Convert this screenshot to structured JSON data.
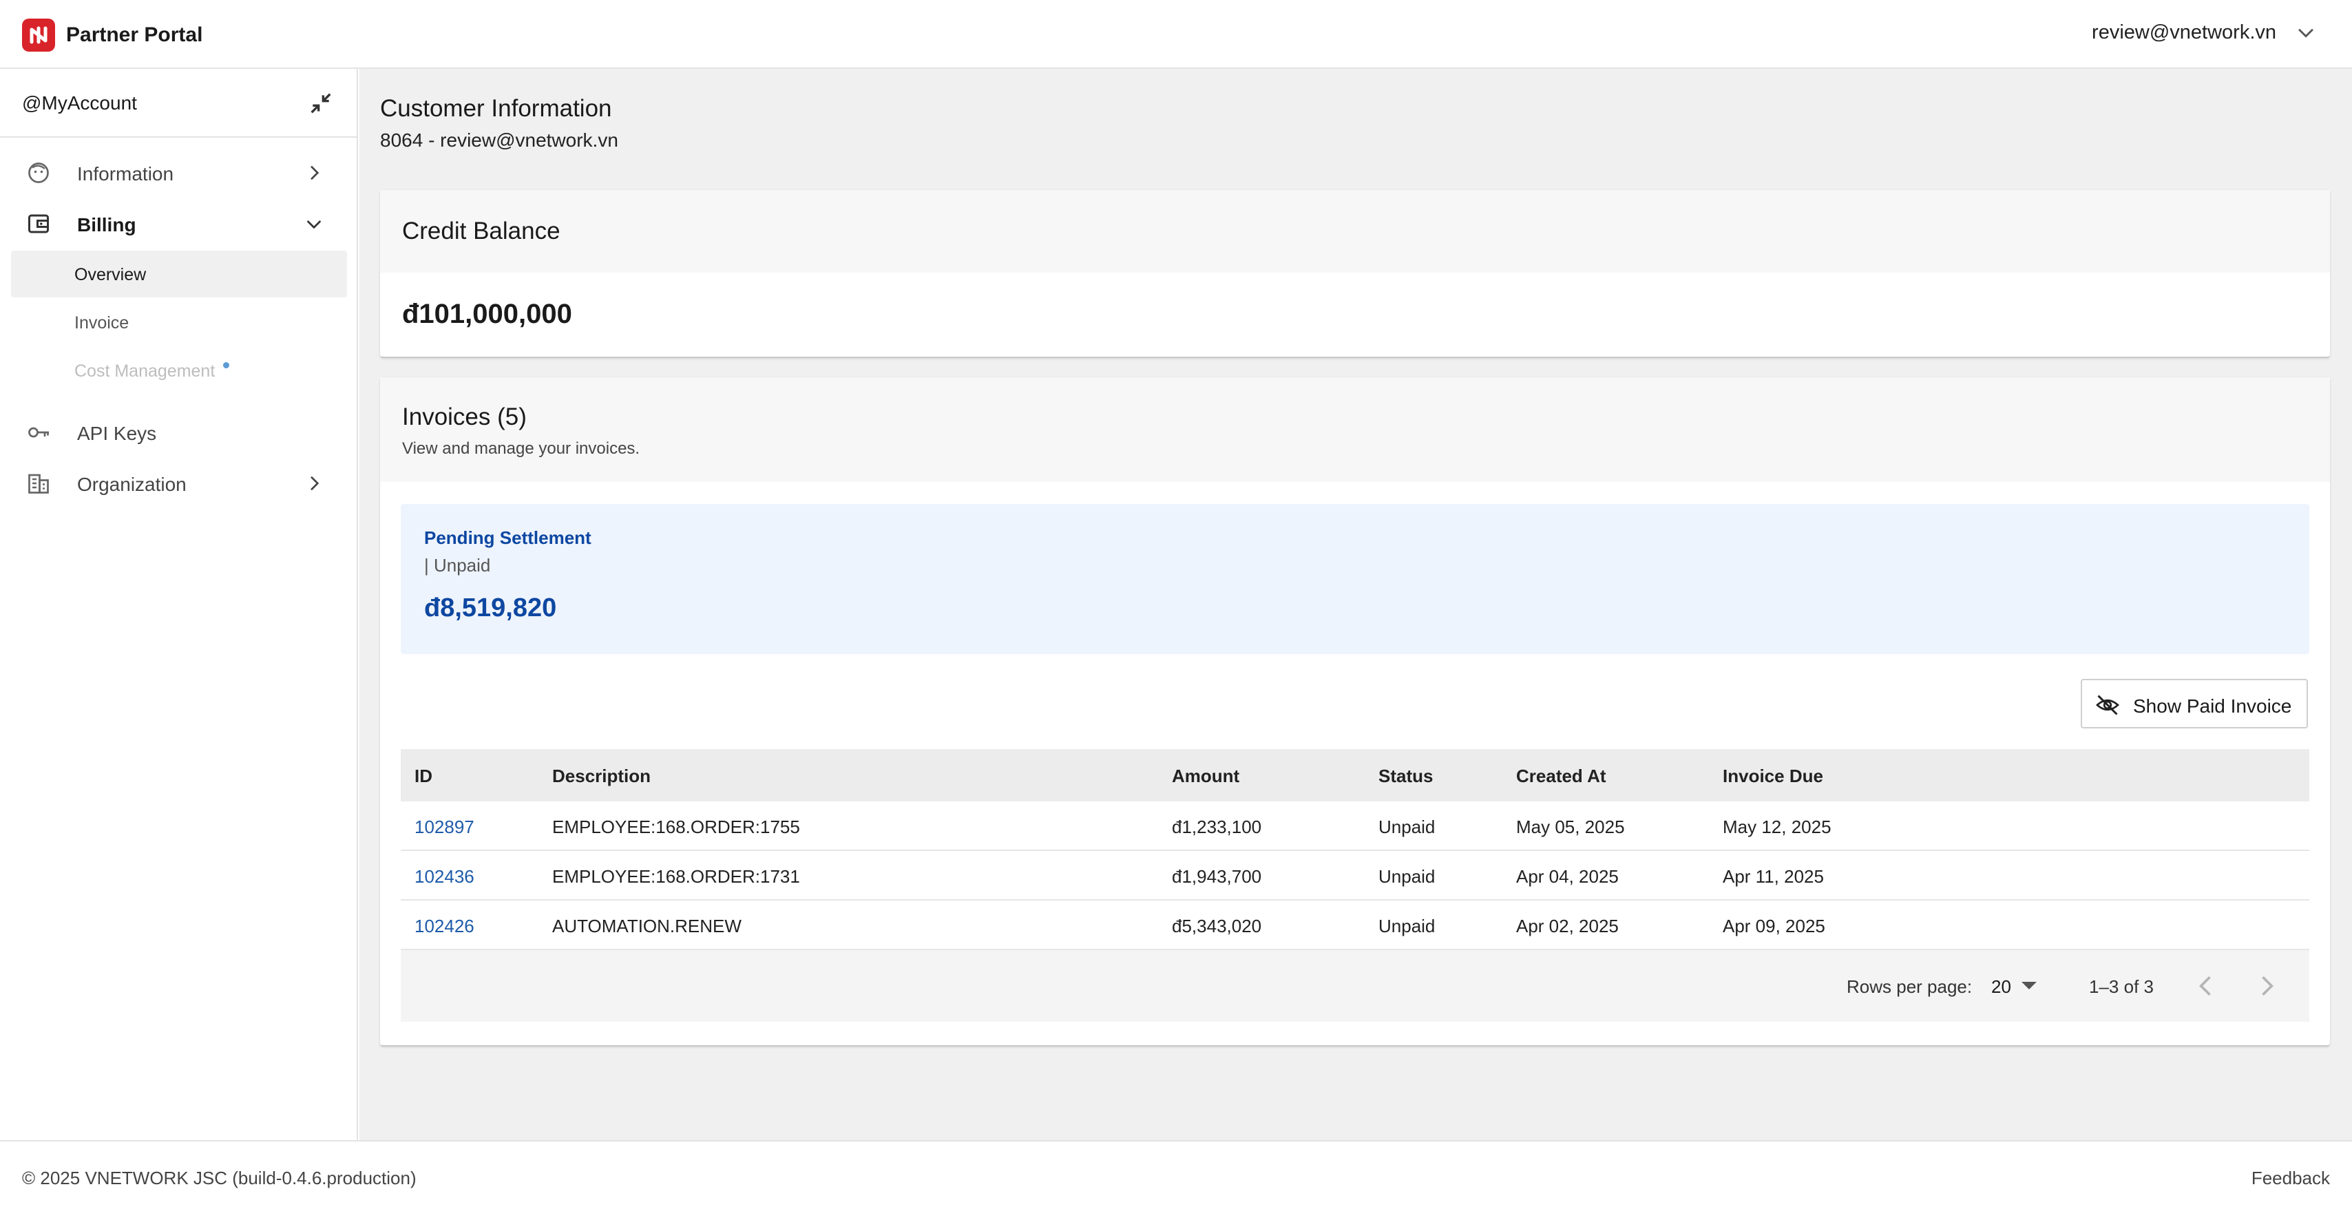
{
  "header": {
    "app_title": "Partner Portal",
    "user_email": "review@vnetwork.vn",
    "brand_color": "#d8232a"
  },
  "sidebar": {
    "account_label": "@MyAccount",
    "items": [
      {
        "label": "Information",
        "icon": "face-icon"
      },
      {
        "label": "Billing",
        "icon": "wallet-icon"
      },
      {
        "label": "API Keys",
        "icon": "key-icon"
      },
      {
        "label": "Organization",
        "icon": "building-icon"
      }
    ],
    "billing_sub": [
      {
        "label": "Overview"
      },
      {
        "label": "Invoice"
      },
      {
        "label": "Cost Management"
      }
    ]
  },
  "main": {
    "title": "Customer Information",
    "subtitle": "8064 - review@vnetwork.vn",
    "credit": {
      "title": "Credit Balance",
      "amount": "đ101,000,000"
    },
    "invoices": {
      "title": "Invoices (5)",
      "subtitle": "View and manage your invoices.",
      "pending": {
        "title": "Pending Settlement",
        "status": "| Unpaid",
        "amount": "đ8,519,820"
      },
      "show_paid_label": "Show Paid Invoice",
      "columns": [
        "ID",
        "Description",
        "Amount",
        "Status",
        "Created At",
        "Invoice Due"
      ],
      "rows": [
        [
          "102897",
          "EMPLOYEE:168.ORDER:1755",
          "đ1,233,100",
          "Unpaid",
          "May 05, 2025",
          "May 12, 2025"
        ],
        [
          "102436",
          "EMPLOYEE:168.ORDER:1731",
          "đ1,943,700",
          "Unpaid",
          "Apr 04, 2025",
          "Apr 11, 2025"
        ],
        [
          "102426",
          "AUTOMATION.RENEW",
          "đ5,343,020",
          "Unpaid",
          "Apr 02, 2025",
          "Apr 09, 2025"
        ]
      ],
      "pagination": {
        "rows_per_page_label": "Rows per page:",
        "rows_per_page": "20",
        "range": "1–3 of 3"
      }
    }
  },
  "footer": {
    "copyright": "© 2025 VNETWORK JSC (build-0.4.6.production)",
    "feedback": "Feedback"
  }
}
